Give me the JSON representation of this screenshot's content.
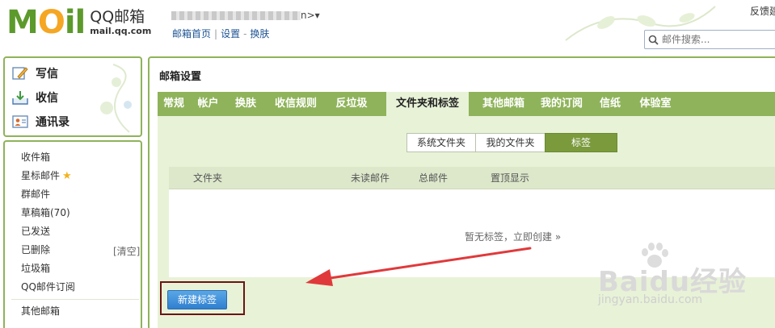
{
  "header": {
    "logo_text": "MOil",
    "app_name": "QQ邮箱",
    "app_url": "mail.qq.com",
    "account_suffix": "n>",
    "nav_links": [
      "邮箱首页",
      "设置",
      "换肤"
    ],
    "feedback": "反馈建",
    "search_placeholder": "邮件搜索..."
  },
  "sidebar": {
    "actions": [
      {
        "label": "写信",
        "icon": "pen-icon"
      },
      {
        "label": "收信",
        "icon": "inbox-download-icon"
      },
      {
        "label": "通讯录",
        "icon": "contacts-icon"
      }
    ],
    "folders": [
      {
        "label": "收件箱"
      },
      {
        "label": "星标邮件",
        "star": "★"
      },
      {
        "label": "群邮件"
      },
      {
        "label": "草稿箱(70)"
      },
      {
        "label": "已发送"
      },
      {
        "label": "已删除",
        "action": "[清空]"
      },
      {
        "label": "垃圾箱"
      },
      {
        "label": "QQ邮件订阅"
      },
      {
        "label": "其他邮箱"
      }
    ]
  },
  "main": {
    "title": "邮箱设置",
    "tabs": [
      "常规",
      "帐户",
      "换肤",
      "收信规则",
      "反垃圾",
      "文件夹和标签",
      "其他邮箱",
      "我的订阅",
      "信纸",
      "体验室"
    ],
    "active_tab": "文件夹和标签",
    "segments": [
      "系统文件夹",
      "我的文件夹",
      "标签"
    ],
    "active_segment": "标签",
    "table": {
      "columns": [
        "文件夹",
        "未读邮件",
        "总邮件",
        "置顶显示"
      ],
      "empty_message": "暂无标签，立即创建 »"
    },
    "new_tag_button": "新建标签"
  },
  "watermark": {
    "brand": "Baidu经验",
    "url": "jingyan.baidu.com"
  },
  "colors": {
    "theme_green": "#8fb35a",
    "content_bg": "#e8f2d7",
    "link_blue": "#1e5494",
    "button_blue": "#2f7fcf",
    "annotation_red": "#e0393b",
    "frame_dark_red": "#6b1414"
  }
}
